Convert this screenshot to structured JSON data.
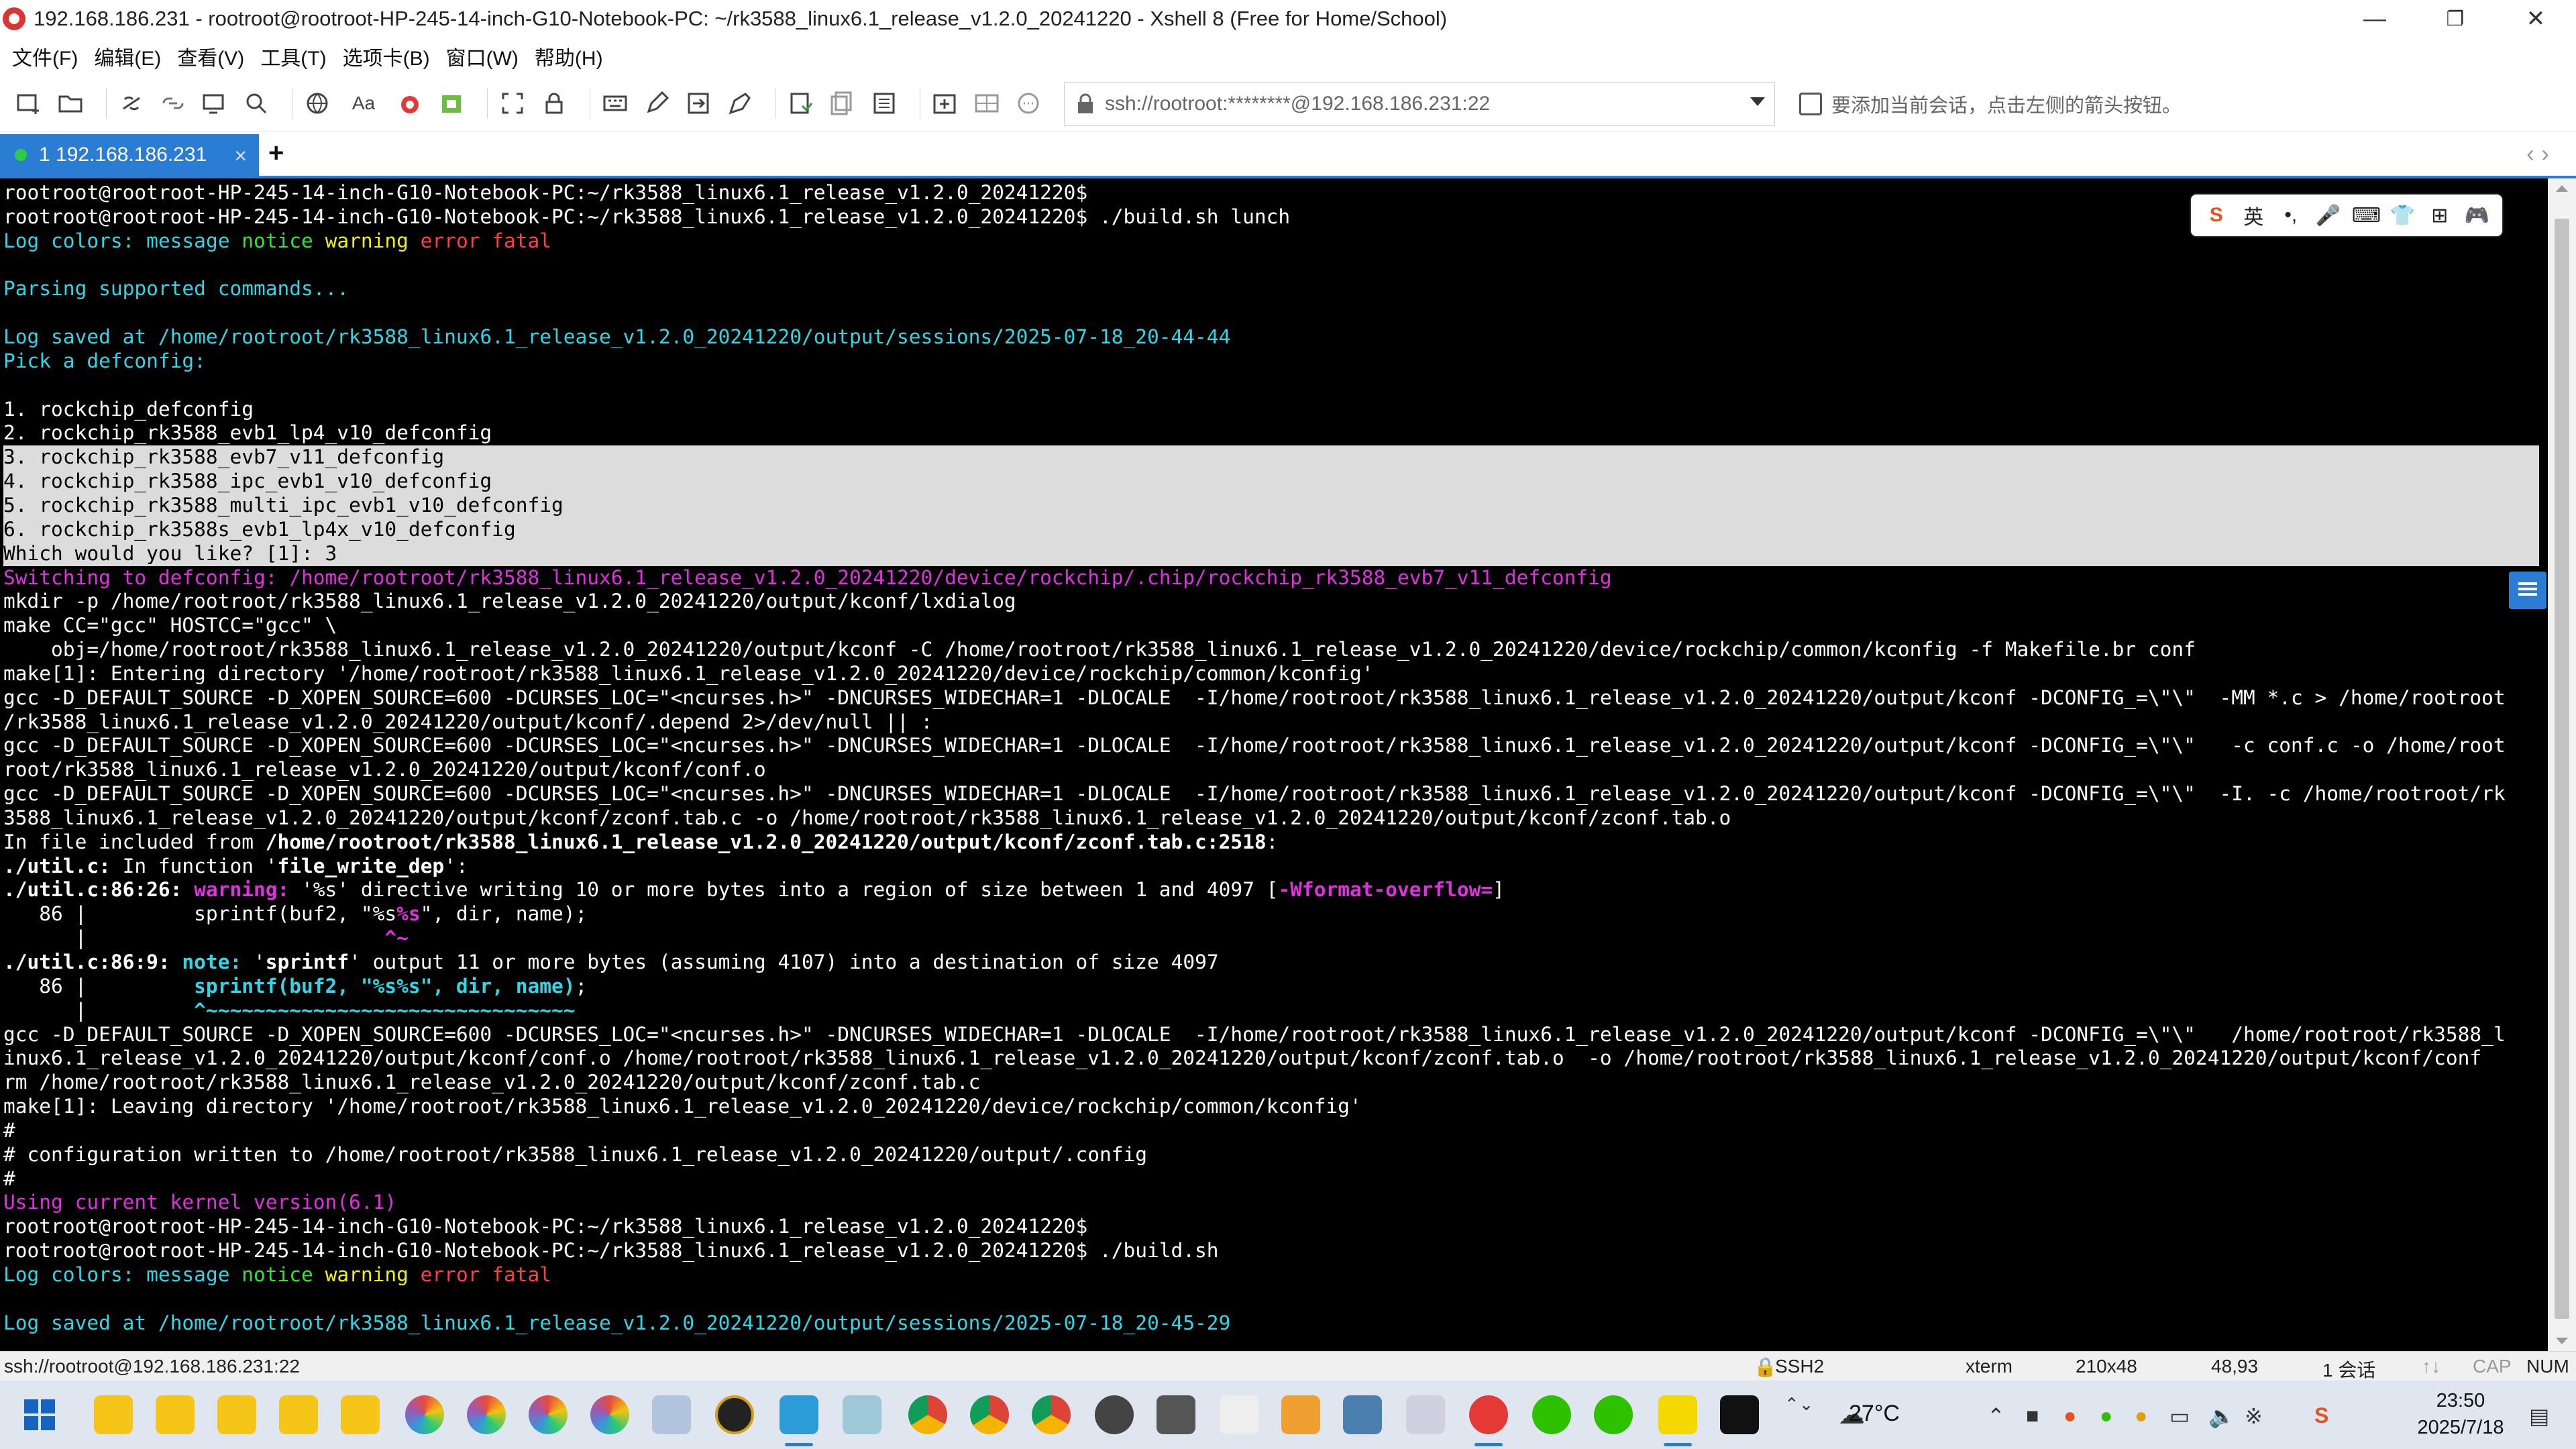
{
  "window": {
    "title": "192.168.186.231 - rootroot@rootroot-HP-245-14-inch-G10-Notebook-PC: ~/rk3588_linux6.1_release_v1.2.0_20241220 - Xshell 8 (Free for Home/School)",
    "minimize": "—",
    "restore": "❐",
    "close": "✕"
  },
  "menu": [
    "文件(F)",
    "编辑(E)",
    "查看(V)",
    "工具(T)",
    "选项卡(B)",
    "窗口(W)",
    "帮助(H)"
  ],
  "toolbar": {
    "address": "ssh://rootroot:********@192.168.186.231:22",
    "hint": "要添加当前会话，点击左侧的箭头按钮。",
    "font_label": "Aa"
  },
  "tabs": [
    {
      "label": "1 192.168.186.231",
      "close": "×"
    }
  ],
  "tab_add": "+",
  "tab_nav": "‹  ›",
  "terminal": {
    "lines": [
      [
        {
          "t": "rootroot@rootroot-HP-245-14-inch-G10-Notebook-PC:~/rk3588_linux6.1_release_v1.2.0_20241220$"
        }
      ],
      [
        {
          "t": "rootroot@rootroot-HP-245-14-inch-G10-Notebook-PC:~/rk3588_linux6.1_release_v1.2.0_20241220$ ./build.sh lunch"
        }
      ],
      [
        {
          "t": "Log colors: ",
          "c": "cyan"
        },
        {
          "t": "message ",
          "c": "cyan"
        },
        {
          "t": "notice ",
          "c": "grn"
        },
        {
          "t": "warning ",
          "c": "yel"
        },
        {
          "t": "error ",
          "c": "red"
        },
        {
          "t": "fatal",
          "c": "red"
        }
      ],
      [
        {
          "t": ""
        }
      ],
      [
        {
          "t": "Parsing supported commands...",
          "c": "cyan"
        }
      ],
      [
        {
          "t": ""
        }
      ],
      [
        {
          "t": "Log saved at /home/rootroot/rk3588_linux6.1_release_v1.2.0_20241220/output/sessions/2025-07-18_20-44-44",
          "c": "cyan"
        }
      ],
      [
        {
          "t": "Pick a defconfig:",
          "c": "cyan"
        }
      ],
      [
        {
          "t": ""
        }
      ],
      [
        {
          "t": "1. rockchip_defconfig"
        }
      ],
      [
        {
          "t": "2. rockchip_rk3588_evb1_lp4_v10_defconfig"
        }
      ],
      [
        {
          "t": "3. rockchip_rk3588_evb7_v11_defconfig",
          "hl": true
        }
      ],
      [
        {
          "t": "4. rockchip_rk3588_ipc_evb1_v10_defconfig",
          "hl": true
        }
      ],
      [
        {
          "t": "5. rockchip_rk3588_multi_ipc_evb1_v10_defconfig",
          "hl": true
        }
      ],
      [
        {
          "t": "6. rockchip_rk3588s_evb1_lp4x_v10_defconfig",
          "hl": true
        }
      ],
      [
        {
          "t": "Which would you like? [1]: 3",
          "hl": true
        }
      ],
      [
        {
          "t": "Switching to defconfig: /home/rootroot/rk3588_linux6.1_release_v1.2.0_20241220/device/rockchip/.chip/rockchip_rk3588_evb7_v11_defconfig",
          "c": "mag"
        }
      ],
      [
        {
          "t": "mkdir -p /home/rootroot/rk3588_linux6.1_release_v1.2.0_20241220/output/kconf/lxdialog"
        }
      ],
      [
        {
          "t": "make CC=\"gcc\" HOSTCC=\"gcc\" \\"
        }
      ],
      [
        {
          "t": "    obj=/home/rootroot/rk3588_linux6.1_release_v1.2.0_20241220/output/kconf -C /home/rootroot/rk3588_linux6.1_release_v1.2.0_20241220/device/rockchip/common/kconfig -f Makefile.br conf"
        }
      ],
      [
        {
          "t": "make[1]: Entering directory '/home/rootroot/rk3588_linux6.1_release_v1.2.0_20241220/device/rockchip/common/kconfig'"
        }
      ],
      [
        {
          "t": "gcc -D_DEFAULT_SOURCE -D_XOPEN_SOURCE=600 -DCURSES_LOC=\"<ncurses.h>\" -DNCURSES_WIDECHAR=1 -DLOCALE  -I/home/rootroot/rk3588_linux6.1_release_v1.2.0_20241220/output/kconf -DCONFIG_=\\\"\\\"  -MM *.c > /home/rootroot"
        }
      ],
      [
        {
          "t": "/rk3588_linux6.1_release_v1.2.0_20241220/output/kconf/.depend 2>/dev/null || :"
        }
      ],
      [
        {
          "t": "gcc -D_DEFAULT_SOURCE -D_XOPEN_SOURCE=600 -DCURSES_LOC=\"<ncurses.h>\" -DNCURSES_WIDECHAR=1 -DLOCALE  -I/home/rootroot/rk3588_linux6.1_release_v1.2.0_20241220/output/kconf -DCONFIG_=\\\"\\\"   -c conf.c -o /home/root"
        }
      ],
      [
        {
          "t": "root/rk3588_linux6.1_release_v1.2.0_20241220/output/kconf/conf.o"
        }
      ],
      [
        {
          "t": "gcc -D_DEFAULT_SOURCE -D_XOPEN_SOURCE=600 -DCURSES_LOC=\"<ncurses.h>\" -DNCURSES_WIDECHAR=1 -DLOCALE  -I/home/rootroot/rk3588_linux6.1_release_v1.2.0_20241220/output/kconf -DCONFIG_=\\\"\\\"  -I. -c /home/rootroot/rk"
        }
      ],
      [
        {
          "t": "3588_linux6.1_release_v1.2.0_20241220/output/kconf/zconf.tab.c -o /home/rootroot/rk3588_linux6.1_release_v1.2.0_20241220/output/kconf/zconf.tab.o"
        }
      ],
      [
        {
          "t": "In file included from "
        },
        {
          "t": "/home/rootroot/rk3588_linux6.1_release_v1.2.0_20241220/output/kconf/zconf.tab.c:2518",
          "b": true
        },
        {
          "t": ":"
        }
      ],
      [
        {
          "t": "./util.c:",
          "b": true
        },
        {
          "t": " In function '"
        },
        {
          "t": "file_write_dep",
          "b": true
        },
        {
          "t": "':"
        }
      ],
      [
        {
          "t": "./util.c:86:26: ",
          "b": true
        },
        {
          "t": "warning: ",
          "c": "mag",
          "b": true
        },
        {
          "t": "'%s' directive writing 10 or more bytes into a region of size between 1 and 4097 ["
        },
        {
          "t": "-Wformat-overflow=",
          "c": "mag",
          "b": true
        },
        {
          "t": "]"
        }
      ],
      [
        {
          "t": "   86 |         sprintf(buf2, \"%s"
        },
        {
          "t": "%s",
          "c": "mag",
          "b": true
        },
        {
          "t": "\", dir, name);"
        }
      ],
      [
        {
          "t": "      |                         "
        },
        {
          "t": "^~",
          "c": "mag",
          "b": true
        }
      ],
      [
        {
          "t": "./util.c:86:9: ",
          "b": true
        },
        {
          "t": "note: ",
          "c": "cyan",
          "b": true
        },
        {
          "t": "'"
        },
        {
          "t": "sprintf",
          "b": true
        },
        {
          "t": "' output 11 or more bytes (assuming 4107) into a destination of size 4097"
        }
      ],
      [
        {
          "t": "   86 |         "
        },
        {
          "t": "sprintf(buf2, \"%s%s\", dir, name)",
          "c": "cyan",
          "b": true
        },
        {
          "t": ";"
        }
      ],
      [
        {
          "t": "      |         "
        },
        {
          "t": "^~~~~~~~~~~~~~~~~~~~~~~~~~~~~~~~",
          "c": "cyan",
          "b": true
        }
      ],
      [
        {
          "t": "gcc -D_DEFAULT_SOURCE -D_XOPEN_SOURCE=600 -DCURSES_LOC=\"<ncurses.h>\" -DNCURSES_WIDECHAR=1 -DLOCALE  -I/home/rootroot/rk3588_linux6.1_release_v1.2.0_20241220/output/kconf -DCONFIG_=\\\"\\\"   /home/rootroot/rk3588_l"
        }
      ],
      [
        {
          "t": "inux6.1_release_v1.2.0_20241220/output/kconf/conf.o /home/rootroot/rk3588_linux6.1_release_v1.2.0_20241220/output/kconf/zconf.tab.o  -o /home/rootroot/rk3588_linux6.1_release_v1.2.0_20241220/output/kconf/conf"
        }
      ],
      [
        {
          "t": "rm /home/rootroot/rk3588_linux6.1_release_v1.2.0_20241220/output/kconf/zconf.tab.c"
        }
      ],
      [
        {
          "t": "make[1]: Leaving directory '/home/rootroot/rk3588_linux6.1_release_v1.2.0_20241220/device/rockchip/common/kconfig'"
        }
      ],
      [
        {
          "t": "#"
        }
      ],
      [
        {
          "t": "# configuration written to /home/rootroot/rk3588_linux6.1_release_v1.2.0_20241220/output/.config"
        }
      ],
      [
        {
          "t": "#"
        }
      ],
      [
        {
          "t": "Using current kernel version(6.1)",
          "c": "mag"
        }
      ],
      [
        {
          "t": "rootroot@rootroot-HP-245-14-inch-G10-Notebook-PC:~/rk3588_linux6.1_release_v1.2.0_20241220$"
        }
      ],
      [
        {
          "t": "rootroot@rootroot-HP-245-14-inch-G10-Notebook-PC:~/rk3588_linux6.1_release_v1.2.0_20241220$ ./build.sh"
        }
      ],
      [
        {
          "t": "Log colors: ",
          "c": "cyan"
        },
        {
          "t": "message ",
          "c": "cyan"
        },
        {
          "t": "notice ",
          "c": "grn"
        },
        {
          "t": "warning ",
          "c": "yel"
        },
        {
          "t": "error ",
          "c": "red"
        },
        {
          "t": "fatal",
          "c": "red"
        }
      ],
      [
        {
          "t": ""
        }
      ],
      [
        {
          "t": "Log saved at /home/rootroot/rk3588_linux6.1_release_v1.2.0_20241220/output/sessions/2025-07-18_20-45-29",
          "c": "cyan"
        }
      ]
    ]
  },
  "ime": [
    "S",
    "英",
    "•,",
    "🎤",
    "⌨",
    "👕",
    "⊞",
    "🎮"
  ],
  "statusbar": {
    "connection": "ssh://rootroot@192.168.186.231:22",
    "protocol": "SSH2",
    "terminal_type": "xterm",
    "size": "210x48",
    "cursor": "48,93",
    "sessions": "1 会话",
    "cap": "CAP",
    "num": "NUM"
  },
  "taskbar": {
    "temperature": "27°C",
    "time": "23:50",
    "date": "2025/7/18"
  },
  "colors": {
    "accent": "#2b7cd3",
    "cyan": "#2fd6e6",
    "magenta": "#e030e0",
    "yellow": "#f2f200",
    "red": "#ff4040",
    "green": "#2ee62e"
  }
}
